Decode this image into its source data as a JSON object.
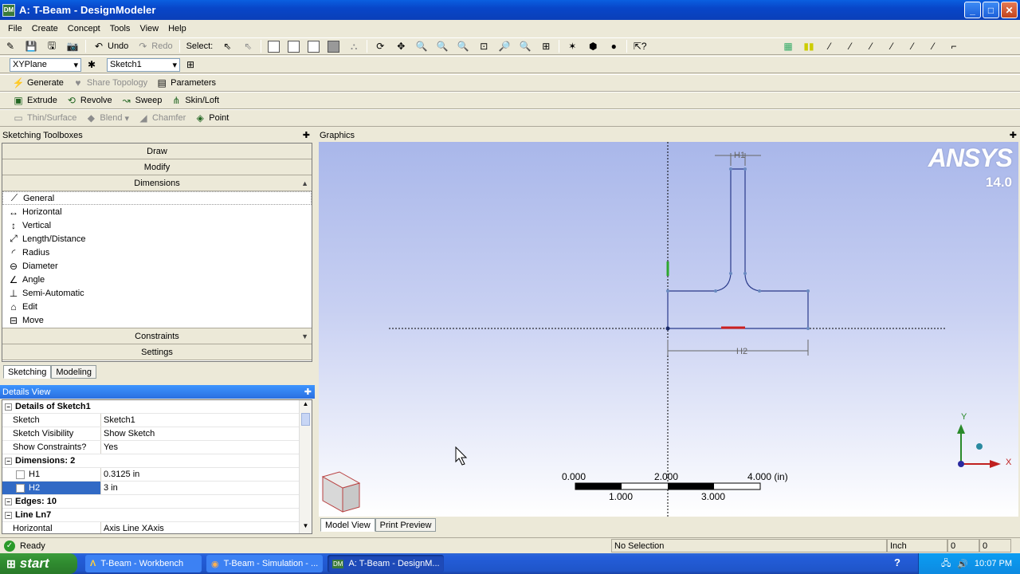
{
  "window": {
    "title": "A: T-Beam - DesignModeler",
    "app_badge": "DM"
  },
  "menu": [
    "File",
    "Create",
    "Concept",
    "Tools",
    "View",
    "Help"
  ],
  "toolbar1": {
    "undo": "Undo",
    "redo": "Redo",
    "select_label": "Select:"
  },
  "toolbar2": {
    "plane": "XYPlane",
    "sketch": "Sketch1"
  },
  "toolbar3": {
    "generate": "Generate",
    "share_topology": "Share Topology",
    "parameters": "Parameters"
  },
  "toolbar4": {
    "extrude": "Extrude",
    "revolve": "Revolve",
    "sweep": "Sweep",
    "skinloft": "Skin/Loft"
  },
  "toolbar5": {
    "thin_surface": "Thin/Surface",
    "blend": "Blend",
    "chamfer": "Chamfer",
    "point": "Point"
  },
  "toolbox": {
    "header": "Sketching Toolboxes",
    "sections": {
      "draw": "Draw",
      "modify": "Modify",
      "dimensions": "Dimensions",
      "constraints": "Constraints",
      "settings": "Settings"
    },
    "dimension_items": [
      "General",
      "Horizontal",
      "Vertical",
      "Length/Distance",
      "Radius",
      "Diameter",
      "Angle",
      "Semi-Automatic",
      "Edit",
      "Move"
    ],
    "tabs": [
      "Sketching",
      "Modeling"
    ]
  },
  "details": {
    "header": "Details View",
    "title": "Details of Sketch1",
    "rows": [
      {
        "k": "Sketch",
        "v": "Sketch1"
      },
      {
        "k": "Sketch Visibility",
        "v": "Show Sketch"
      },
      {
        "k": "Show Constraints?",
        "v": "Yes"
      }
    ],
    "dimensions_group": "Dimensions: 2",
    "dims": [
      {
        "k": "H1",
        "v": "0.3125 in"
      },
      {
        "k": "H2",
        "v": "3 in"
      }
    ],
    "edges_group": "Edges: 10",
    "line_group": "Line Ln7",
    "line_row": {
      "k": "Horizontal",
      "v": "Axis Line XAxis"
    }
  },
  "graphics": {
    "header": "Graphics",
    "logo": "ANSYS",
    "version": "14.0",
    "dim_top": "H1",
    "dim_bottom": "H2",
    "scale_top": [
      "0.000",
      "2.000",
      "4.000 (in)"
    ],
    "scale_bottom": [
      "1.000",
      "3.000"
    ],
    "axis_y": "Y",
    "axis_x": "X",
    "tabs": [
      "Model View",
      "Print Preview"
    ]
  },
  "status": {
    "ready": "Ready",
    "selection": "No Selection",
    "units": "Inch",
    "c1": "0",
    "c2": "0"
  },
  "taskbar": {
    "start": "start",
    "tasks": [
      "T-Beam - Workbench",
      "T-Beam - Simulation - ...",
      "A: T-Beam - DesignM..."
    ],
    "time": "10:07 PM"
  }
}
